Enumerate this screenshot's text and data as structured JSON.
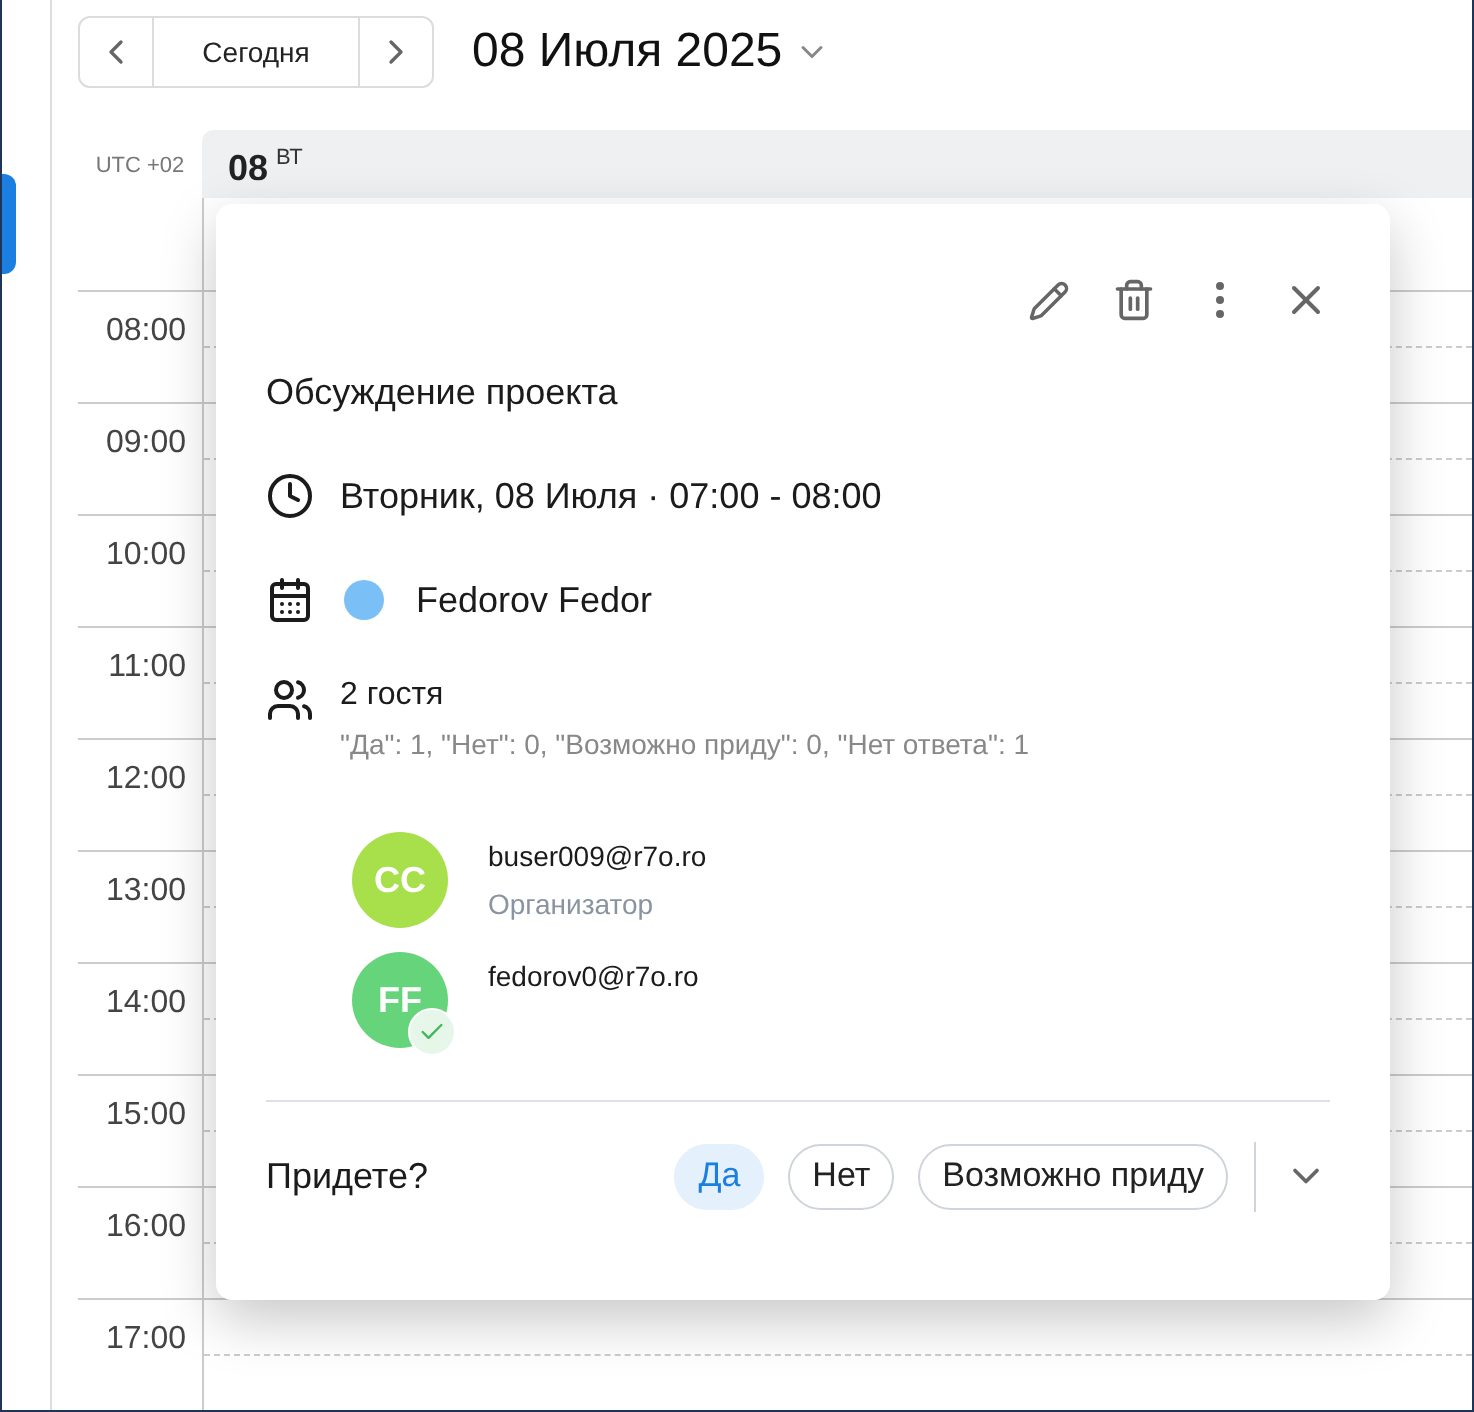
{
  "toolbar": {
    "today": "Сегодня",
    "date_title": "08 Июля 2025"
  },
  "timezone": "UTC +02",
  "day": {
    "number": "08",
    "weekday": "ВТ"
  },
  "hours": [
    "08:00",
    "09:00",
    "10:00",
    "11:00",
    "12:00",
    "13:00",
    "14:00",
    "15:00",
    "16:00",
    "17:00"
  ],
  "event": {
    "title": "Обсуждение проекта",
    "when": "Вторник, 08 Июля · 07:00 - 08:00",
    "calendar": {
      "name": "Fedorov Fedor",
      "color": "#7bbff7"
    },
    "guests": {
      "count": "2 гостя",
      "summary": "\"Да\": 1, \"Нет\": 0, \"Возможно приду\": 0, \"Нет ответа\": 1"
    },
    "attendees": [
      {
        "initials": "CC",
        "email": "buser009@r7o.ro",
        "role": "Организатор",
        "color": "#a8e04b",
        "accepted": false
      },
      {
        "initials": "FF",
        "email": "fedorov0@r7o.ro",
        "color": "#66d47a",
        "accepted": true
      }
    ],
    "rsvp": {
      "question": "Придете?",
      "options": [
        {
          "label": "Да",
          "selected": true
        },
        {
          "label": "Нет",
          "selected": false
        },
        {
          "label": "Возможно приду",
          "selected": false
        }
      ]
    }
  }
}
